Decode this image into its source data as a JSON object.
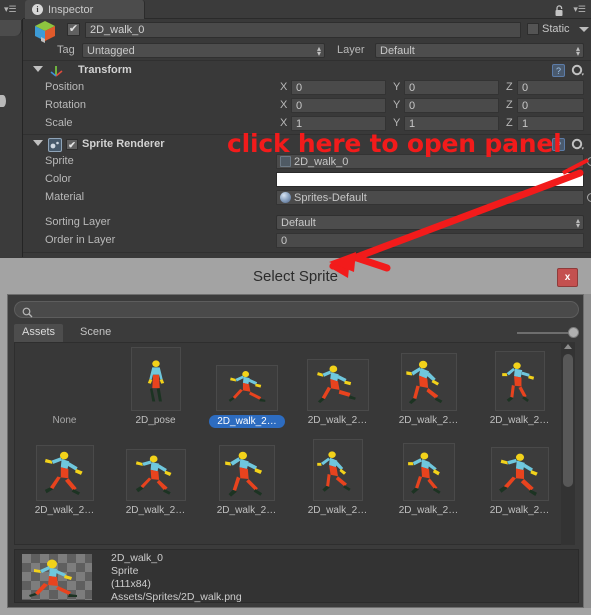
{
  "window": {
    "tab_label": "Inspector",
    "info_icon": "info-icon",
    "lock_icon": "lock-icon",
    "menu_icon": "hamburger-menu-icon"
  },
  "game_object": {
    "enabled_check": "✔",
    "name": "2D_walk_0",
    "static_label": "Static",
    "tag_label": "Tag",
    "tag_value": "Untagged",
    "layer_label": "Layer",
    "layer_value": "Default"
  },
  "transform": {
    "title": "Transform",
    "help_label": "?",
    "rows": [
      {
        "label": "Position",
        "x": "0",
        "y": "0",
        "z": "0"
      },
      {
        "label": "Rotation",
        "x": "0",
        "y": "0",
        "z": "0"
      },
      {
        "label": "Scale",
        "x": "1",
        "y": "1",
        "z": "1"
      }
    ],
    "axis": {
      "x": "X",
      "y": "Y",
      "z": "Z"
    }
  },
  "sprite_renderer": {
    "title": "Sprite Renderer",
    "enabled_check": "✔",
    "sprite_label": "Sprite",
    "sprite_value": "2D_walk_0",
    "color_label": "Color",
    "color_value": "#FFFFFF",
    "material_label": "Material",
    "material_value": "Sprites-Default",
    "sorting_layer_label": "Sorting Layer",
    "sorting_layer_value": "Default",
    "order_label": "Order in Layer",
    "order_value": "0"
  },
  "annotation": {
    "text": "click here to open panel",
    "color": "#f21b1b"
  },
  "dialog": {
    "title": "Select Sprite",
    "close_label": "x",
    "search_placeholder": "",
    "search_value": "",
    "tabs": [
      {
        "label": "Assets",
        "active": true
      },
      {
        "label": "Scene",
        "active": false
      }
    ],
    "items": [
      {
        "label": "None",
        "selected": false,
        "thumb": "none"
      },
      {
        "label": "2D_pose",
        "selected": false,
        "thumb": "pose"
      },
      {
        "label": "2D_walk_2…",
        "selected": true,
        "thumb": "walk-a"
      },
      {
        "label": "2D_walk_2…",
        "selected": false,
        "thumb": "walk-b"
      },
      {
        "label": "2D_walk_2…",
        "selected": false,
        "thumb": "walk-c"
      },
      {
        "label": "2D_walk_2…",
        "selected": false,
        "thumb": "walk-d"
      },
      {
        "label": "2D_walk_2…",
        "selected": false,
        "thumb": "walk-e"
      },
      {
        "label": "2D_walk_2…",
        "selected": false,
        "thumb": "walk-f"
      },
      {
        "label": "2D_walk_2…",
        "selected": false,
        "thumb": "walk-g"
      },
      {
        "label": "2D_walk_2…",
        "selected": false,
        "thumb": "walk-h"
      },
      {
        "label": "2D_walk_2…",
        "selected": false,
        "thumb": "walk-i"
      },
      {
        "label": "2D_walk_2…",
        "selected": false,
        "thumb": "walk-j"
      }
    ],
    "preview": {
      "name": "2D_walk_0",
      "type": "Sprite",
      "dimensions": "(111x84)",
      "path": "Assets/Sprites/2D_walk.png"
    }
  }
}
